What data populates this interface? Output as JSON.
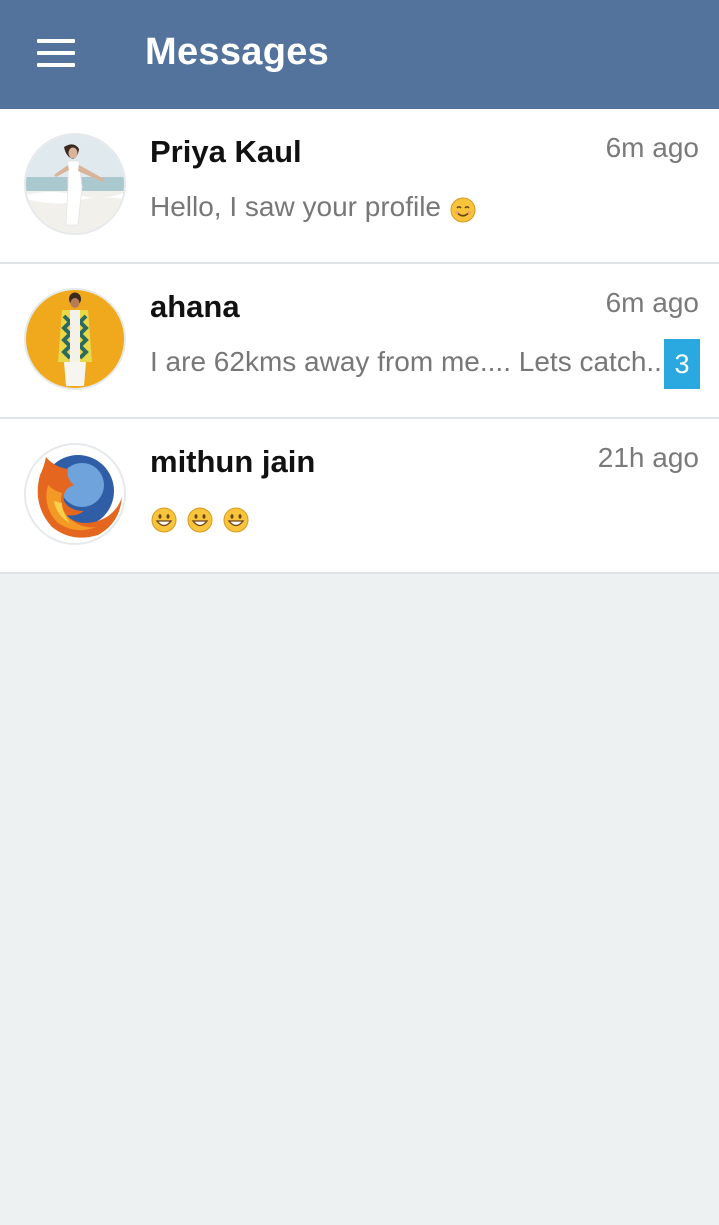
{
  "header": {
    "title": "Messages",
    "menu_icon": "hamburger-menu-icon",
    "background": "#53739d"
  },
  "conversations": [
    {
      "name": "Priya Kaul",
      "time": "6m ago",
      "preview": "Hello, I saw your profile",
      "preview_emoji": [
        "smiling-face-emoji"
      ],
      "unread": null,
      "avatar": "beach-photo-avatar"
    },
    {
      "name": "ahana",
      "time": "6m ago",
      "preview": "I are 62kms away from me.... Lets catch...",
      "preview_emoji": [],
      "unread": "3",
      "avatar": "yellow-background-photo-avatar"
    },
    {
      "name": "mithun jain",
      "time": "21h ago",
      "preview": "",
      "preview_emoji": [
        "grinning-face-emoji",
        "grinning-face-emoji",
        "grinning-face-emoji"
      ],
      "unread": null,
      "avatar": "firefox-logo-avatar"
    }
  ],
  "colors": {
    "badge": "#2aa8e0",
    "list_background": "#edf1f2"
  }
}
